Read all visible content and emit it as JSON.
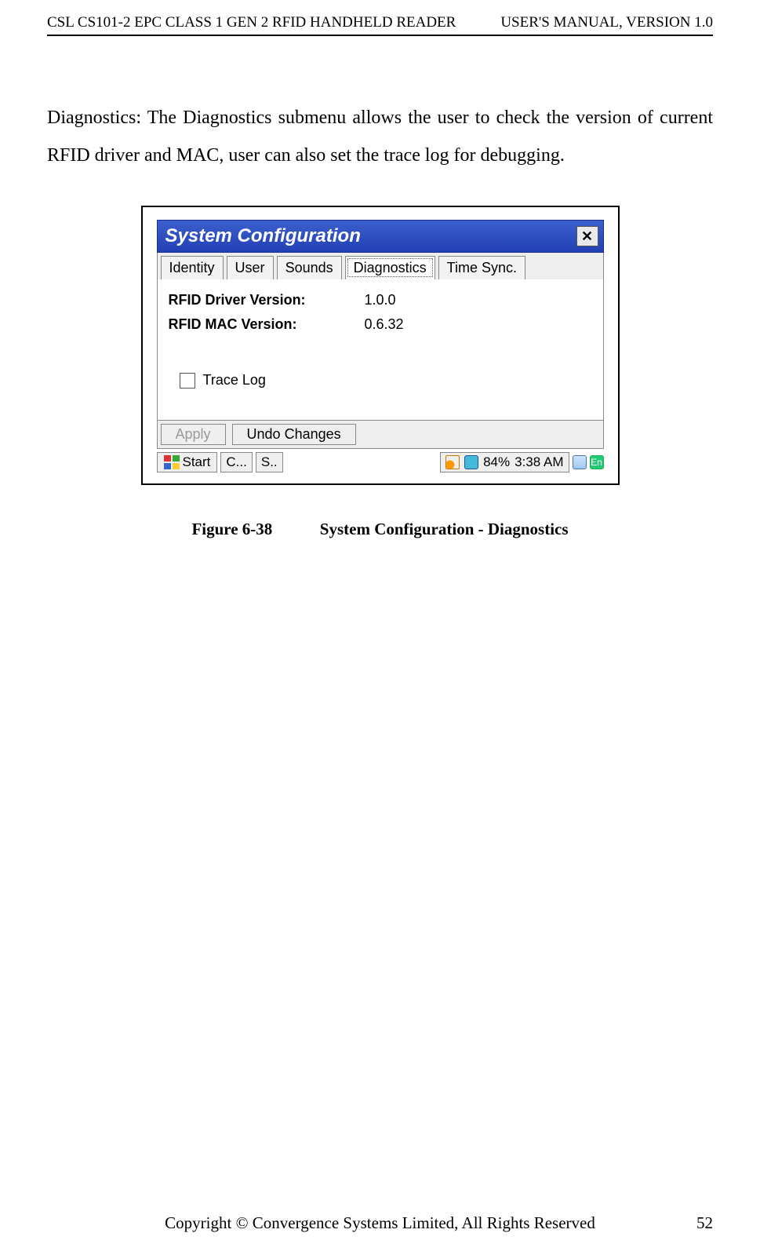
{
  "header": {
    "left": "CSL CS101-2 EPC CLASS 1 GEN 2 RFID HANDHELD READER",
    "right": "USER'S  MANUAL,  VERSION  1.0"
  },
  "paragraph": "Diagnostics: The Diagnostics submenu allows the user to check the version of current RFID driver and MAC, user can also set the trace log for debugging.",
  "window": {
    "title": "System Configuration",
    "close": "✕",
    "tabs": [
      "Identity",
      "User",
      "Sounds",
      "Diagnostics",
      "Time Sync."
    ],
    "activeTabIndex": 3,
    "rows": [
      {
        "label": "RFID Driver Version:",
        "value": "1.0.0"
      },
      {
        "label": "RFID MAC Version:",
        "value": "0.6.32"
      }
    ],
    "tracelog": {
      "label": "Trace Log",
      "checked": false
    },
    "buttons": {
      "apply": "Apply",
      "undo": "Undo Changes"
    },
    "taskbar": {
      "start": "Start",
      "items": [
        "C...",
        "S.."
      ],
      "battery": "84%",
      "time": "3:38 AM",
      "kb": "En"
    }
  },
  "caption": {
    "fig": "Figure 6-38",
    "title": "System Configuration - Diagnostics"
  },
  "footer": {
    "text": "Copyright © Convergence Systems Limited, All Rights Reserved",
    "page": "52"
  }
}
